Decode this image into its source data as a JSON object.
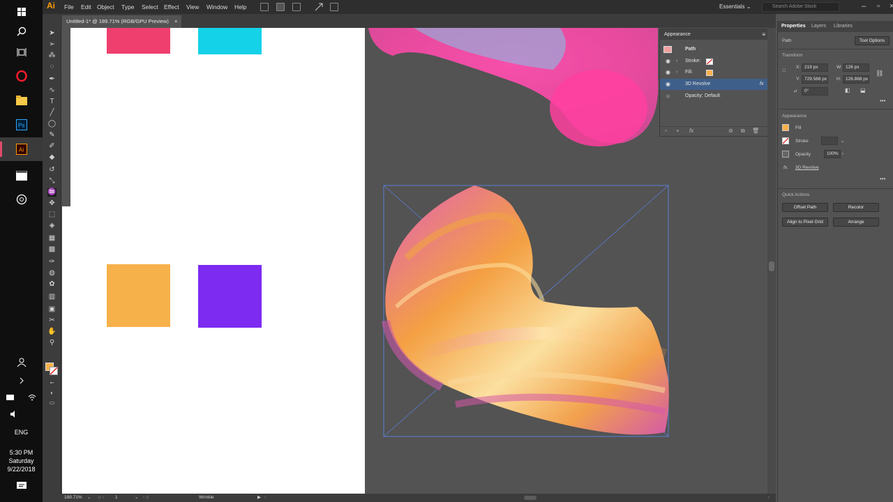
{
  "taskbar": {
    "apps": [
      "windows-start",
      "search",
      "task-view",
      "opera",
      "file-explorer",
      "photoshop",
      "illustrator",
      "media-player",
      "settings"
    ],
    "clock": {
      "time": "5:30 PM",
      "day": "Saturday",
      "date": "9/22/2018"
    },
    "lang": "ENG"
  },
  "menubar": {
    "logo": "Ai",
    "items": [
      "File",
      "Edit",
      "Object",
      "Type",
      "Select",
      "Effect",
      "View",
      "Window",
      "Help"
    ],
    "workspace": "Essentials",
    "search_placeholder": "Search Adobe Stock"
  },
  "document": {
    "tab_title": "Untitled-1* @ 189.71% (RGB/GPU Preview)",
    "close": "×"
  },
  "artboard": {
    "swatches": [
      {
        "name": "pink",
        "color": "#ef3f6e"
      },
      {
        "name": "cyan",
        "color": "#14d2e8"
      },
      {
        "name": "orange",
        "color": "#f7b14b"
      },
      {
        "name": "purple",
        "color": "#7d2af1"
      }
    ]
  },
  "appearance_panel": {
    "title": "Appearance",
    "object": "Path",
    "rows": [
      {
        "label": "Stroke:",
        "swatch": "none"
      },
      {
        "label": "Fill:",
        "swatch": "#f7b14b"
      },
      {
        "label": "3D Revolve",
        "fx": "fx"
      },
      {
        "label": "Opacity:",
        "value": "Default"
      }
    ]
  },
  "properties": {
    "tabs": [
      "Properties",
      "Layers",
      "Libraries"
    ],
    "object_type": "Path",
    "tool_options": "Tool Options",
    "transform": {
      "title": "Transform",
      "x": "219 px",
      "y": "729.566 px",
      "w": "126 px",
      "h": "126.868 px",
      "angle": "0°",
      "x_label": "X:",
      "y_label": "Y:",
      "w_label": "W:",
      "h_label": "H:"
    },
    "appearance": {
      "title": "Appearance",
      "fill": "Fill",
      "stroke": "Stroke",
      "opacity_label": "Opacity",
      "opacity": "100%",
      "effect": "3D Revolve"
    },
    "quick_actions": {
      "title": "Quick Actions",
      "buttons": [
        "Offset Path",
        "Recolor",
        "Align to Pixel Grid",
        "Arrange"
      ]
    }
  },
  "statusbar": {
    "zoom": "189.71%",
    "artboard": "1",
    "tool": "Wrinkle"
  }
}
